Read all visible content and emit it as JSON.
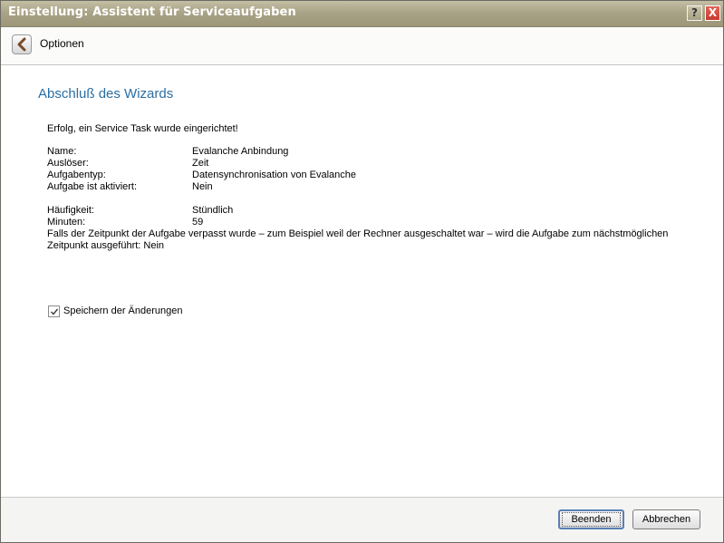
{
  "window": {
    "title": "Einstellung: Assistent für Serviceaufgaben",
    "help_label": "?",
    "close_label": "X"
  },
  "toolbar": {
    "back_icon": "chevron-left-icon",
    "label": "Optionen"
  },
  "content": {
    "heading": "Abschluß des Wizards",
    "success_message": "Erfolg, ein Service Task wurde eingerichtet!",
    "details": [
      {
        "label": "Name:",
        "value": "Evalanche Anbindung"
      },
      {
        "label": "Auslöser:",
        "value": "Zeit"
      },
      {
        "label": "Aufgabentyp:",
        "value": "Datensynchronisation von Evalanche"
      },
      {
        "label": "Aufgabe ist aktiviert:",
        "value": "Nein"
      }
    ],
    "schedule": [
      {
        "label": "Häufigkeit:",
        "value": "Stündlich"
      },
      {
        "label": "Minuten:",
        "value": "59"
      }
    ],
    "note_line1": "Falls der Zeitpunkt der Aufgabe verpasst wurde – zum Beispiel weil der Rechner ausgeschaltet war – wird die Aufgabe zum nächstmöglichen",
    "note_line2": "Zeitpunkt ausgeführt: Nein",
    "save_checkbox": {
      "label": "Speichern der Änderungen",
      "checked": true
    }
  },
  "footer": {
    "finish_label": "Beenden",
    "cancel_label": "Abbrechen"
  }
}
